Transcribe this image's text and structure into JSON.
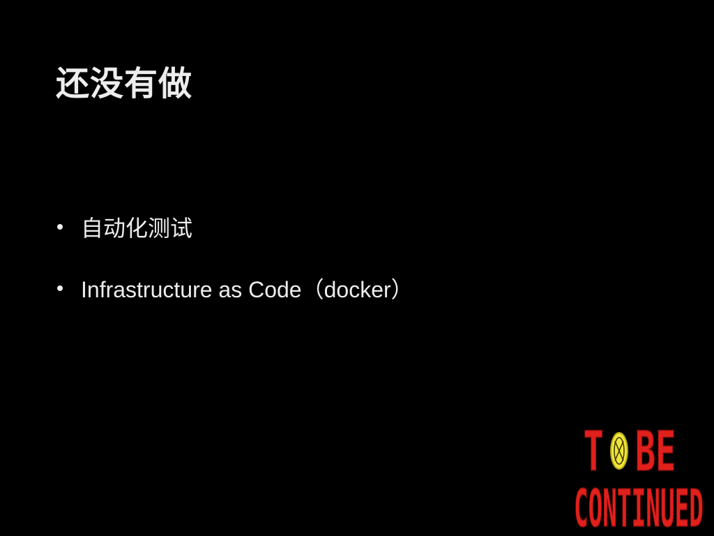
{
  "slide": {
    "title": "还没有做",
    "bullets": [
      {
        "text": "自动化测试"
      },
      {
        "text": "Infrastructure as Code（docker）"
      }
    ]
  },
  "logo": {
    "line1_left": "T",
    "line1_right": "BE",
    "line2": "CONTINUED",
    "text_color": "#e0201c",
    "circle_color": "#f0e63a"
  },
  "colors": {
    "background": "#000000",
    "text": "#ededed"
  }
}
